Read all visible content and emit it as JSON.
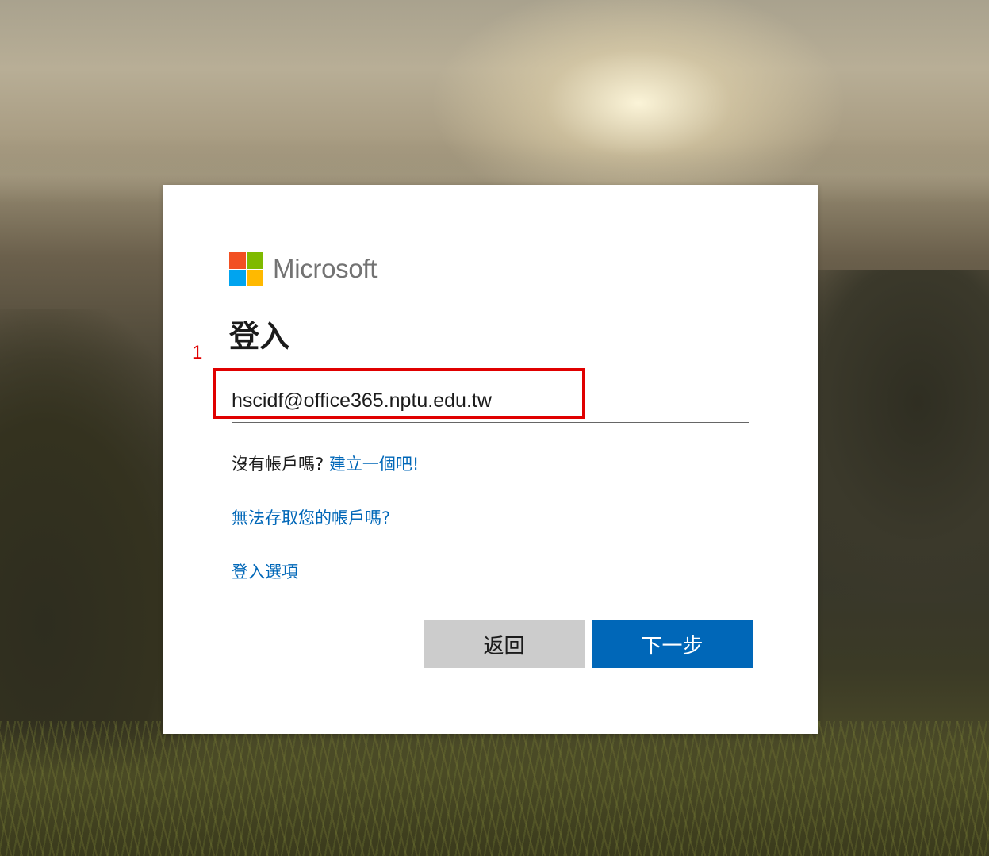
{
  "brand": {
    "name": "Microsoft",
    "logo_colors": [
      "#f25022",
      "#7fba00",
      "#00a4ef",
      "#ffb900"
    ],
    "text_color": "#737373"
  },
  "page": {
    "title": "登入",
    "annotation_number": "1",
    "annotation_color": "#e00000"
  },
  "email": {
    "value": "hscidf@office365.nptu.edu.tw"
  },
  "links": {
    "no_account_prefix": "沒有帳戶嗎?",
    "create_account": "建立一個吧!",
    "cant_access": "無法存取您的帳戶嗎?",
    "signin_options": "登入選項",
    "link_color": "#0067b8"
  },
  "buttons": {
    "back": "返回",
    "next": "下一步",
    "primary_color": "#0067b8",
    "secondary_color": "#cccccc"
  }
}
